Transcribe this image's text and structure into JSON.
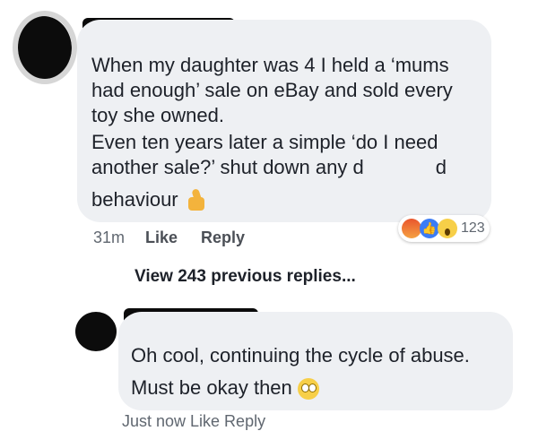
{
  "comment1": {
    "lines": [
      "When my daughter was 4 I held a ‘mums",
      "had enough’ sale on eBay and sold every",
      "toy she owned.",
      "Even ten years later a simple ‘do I need"
    ],
    "line5_start": "another sale?’ shut down any d",
    "line5_end": "d",
    "line6": "behaviour",
    "emoji": "thumbs-up-icon",
    "time": "31m",
    "like_label": "Like",
    "reply_label": "Reply",
    "reaction_count": "123",
    "reactions": [
      "angry-icon",
      "like-icon",
      "wow-icon"
    ]
  },
  "view_replies_label": "View 243 previous replies...",
  "comment2": {
    "lines": [
      "Oh cool, continuing the cycle of abuse.",
      "Must be okay then"
    ],
    "emoji": "rolling-eyes-icon",
    "cut_off_actions": "Just now    Like    Reply"
  },
  "colors": {
    "bubble": "#eef0f3",
    "action_text": "#4b4f56",
    "meta_text": "#606770"
  }
}
